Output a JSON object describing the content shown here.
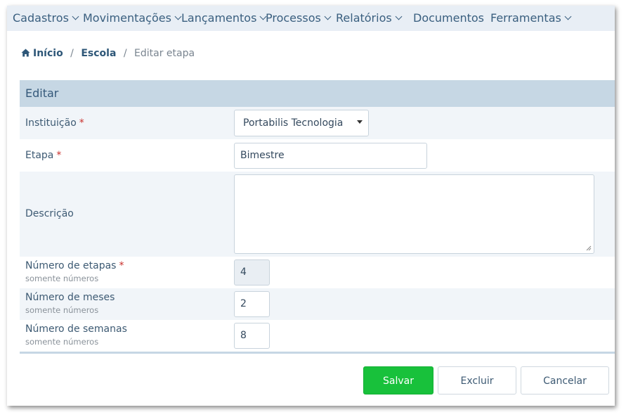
{
  "menu": {
    "items": [
      {
        "label": "Cadastros",
        "has_dropdown": true
      },
      {
        "label": "Movimentações",
        "has_dropdown": true
      },
      {
        "label": "Lançamentos",
        "has_dropdown": true
      },
      {
        "label": "Processos",
        "has_dropdown": true
      },
      {
        "label": "Relatórios",
        "has_dropdown": true
      },
      {
        "label": "Documentos",
        "has_dropdown": false
      },
      {
        "label": "Ferramentas",
        "has_dropdown": true
      }
    ]
  },
  "breadcrumb": {
    "home": "Início",
    "section": "Escola",
    "current": "Editar etapa",
    "separator": "/"
  },
  "panel": {
    "title": "Editar"
  },
  "form": {
    "instituicao": {
      "label": "Instituição",
      "required_mark": "*",
      "value": "Portabilis Tecnologia"
    },
    "etapa": {
      "label": "Etapa",
      "required_mark": "*",
      "value": "Bimestre"
    },
    "descricao": {
      "label": "Descrição",
      "value": ""
    },
    "numero_etapas": {
      "label": "Número de etapas",
      "required_mark": "*",
      "hint": "somente números",
      "value": "4"
    },
    "numero_meses": {
      "label": "Número de meses",
      "hint": "somente números",
      "value": "2"
    },
    "numero_semanas": {
      "label": "Número de semanas",
      "hint": "somente números",
      "value": "8"
    }
  },
  "actions": {
    "save": "Salvar",
    "delete": "Excluir",
    "cancel": "Cancelar"
  },
  "colors": {
    "menu_bg": "#e8eef5",
    "menu_text": "#3a5f7f",
    "panel_header_bg": "#c6d7e4",
    "row_shade": "#f1f5f9",
    "required": "#c9302c",
    "primary_button": "#18c13b"
  }
}
